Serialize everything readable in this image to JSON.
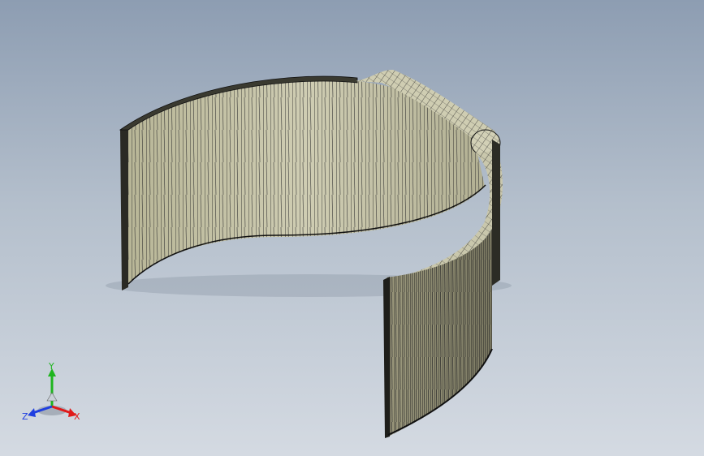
{
  "viewport": {
    "background_top": "#8d9db2",
    "background_bottom": "#d4dae2",
    "model_fill": "#bdb99a",
    "model_inner_fill": "#c9c7ac",
    "edge_color": "#1c1c1c"
  },
  "triad": {
    "x_label": "X",
    "y_label": "Y",
    "z_label": "Z",
    "x_color": "#e01a1a",
    "y_color": "#1fb51f",
    "z_color": "#1f3fe0"
  }
}
